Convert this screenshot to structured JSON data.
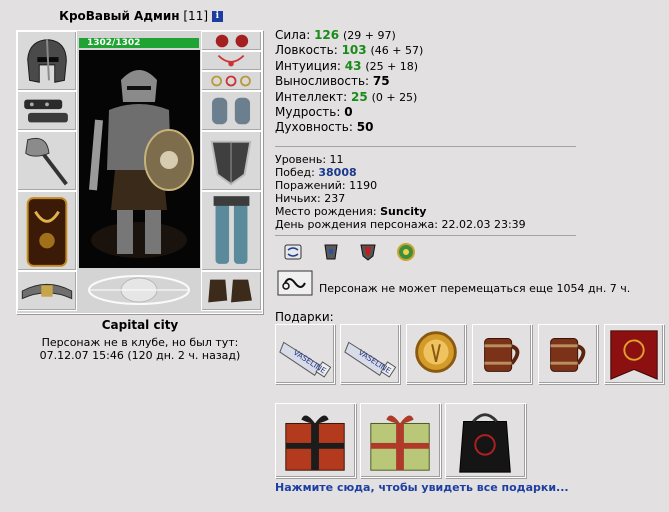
{
  "character": {
    "name": "КроВавый Админ",
    "level_bracket": "[11]",
    "info_icon_glyph": "i",
    "hp_text": "1302/1302",
    "hp_fraction": 1.0,
    "location": "Capital city",
    "absence_line1": "Персонаж не в клубе, но был тут:",
    "absence_line2": "07.12.07 15:46 (120 дн. 2 ч. назад)"
  },
  "stats": [
    {
      "label": "Сила:",
      "value": "126",
      "extra": "(29 + 97)",
      "green": true
    },
    {
      "label": "Ловкость:",
      "value": "103",
      "extra": "(46 + 57)",
      "green": true
    },
    {
      "label": "Интуиция:",
      "value": "43",
      "extra": "(25 + 18)",
      "green": true
    },
    {
      "label": "Выносливость:",
      "value": "75",
      "extra": "",
      "green": false
    },
    {
      "label": "Интеллект:",
      "value": "25",
      "extra": "(0 + 25)",
      "green": true
    },
    {
      "label": "Мудрость:",
      "value": "0",
      "extra": "",
      "green": false
    },
    {
      "label": "Духовность:",
      "value": "50",
      "extra": "",
      "green": false
    }
  ],
  "info": {
    "level_label": "Уровень:",
    "level_value": "11",
    "wins_label": "Побед:",
    "wins_value": "38008",
    "losses_label": "Поражений:",
    "losses_value": "1190",
    "draws_label": "Ничьих:",
    "draws_value": "237",
    "birthplace_label": "Место рождения:",
    "birthplace_value": "Suncity",
    "birthday_label": "День рождения персонажа:",
    "birthday_value": "22.02.03 23:39"
  },
  "badges": [
    "scroll-badge-icon",
    "guild-tower-icon",
    "red-shield-badge-icon",
    "green-emblem-icon"
  ],
  "movement_text": "Персонаж не может перемещаться еще 1054 дн. 7 ч.",
  "gifts_title": "Подарки:",
  "gifts_row1": [
    "vaseline-gift-icon",
    "vaseline-gift-icon",
    "gold-coin-gift-icon",
    "beer-mug-gift-icon",
    "beer-mug-gift-icon",
    "red-banner-gift-icon"
  ],
  "gifts_row2": [
    "red-gift-box-icon",
    "green-gift-box-icon",
    "black-gift-bag-icon"
  ],
  "vaseline_text": "VASELINE",
  "all_gifts_link": "Нажмите сюда, чтобы увидеть все подарки...",
  "colors": {
    "green": "#1a8b1a",
    "link_blue": "#1e3fa2",
    "hp_green": "#1fa332",
    "background": "#e2e0e0"
  }
}
